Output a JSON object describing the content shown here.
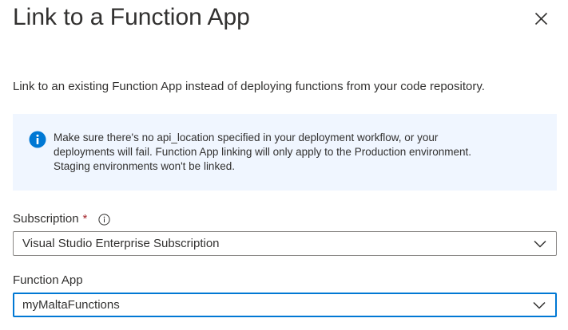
{
  "panel": {
    "title": "Link to a Function App",
    "close_icon": "close-icon",
    "description": "Link to an existing Function App instead of deploying functions from your code repository."
  },
  "info": {
    "icon": "info-icon",
    "line1": "Make sure there's no api_location specified in your deployment workflow, or your",
    "line2": "deployments will fail. Function App linking will only apply to the Production environment.",
    "line3": "Staging environments won't be linked."
  },
  "subscription": {
    "label": "Subscription",
    "required_marker": "*",
    "help_icon": "info-circle-icon",
    "value": "Visual Studio Enterprise Subscription"
  },
  "function_app": {
    "label": "Function App",
    "value": "myMaltaFunctions"
  },
  "colors": {
    "accent": "#0078d4",
    "info_background": "#f0f6ff",
    "required": "#a4262c"
  }
}
